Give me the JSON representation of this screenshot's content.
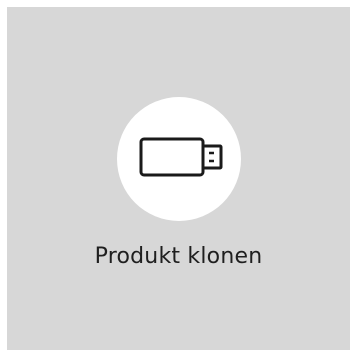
{
  "tile": {
    "label": "Produkt klonen",
    "icon": "usb-drive-icon",
    "background_color": "#d7d7d7",
    "circle_color": "#ffffff"
  }
}
